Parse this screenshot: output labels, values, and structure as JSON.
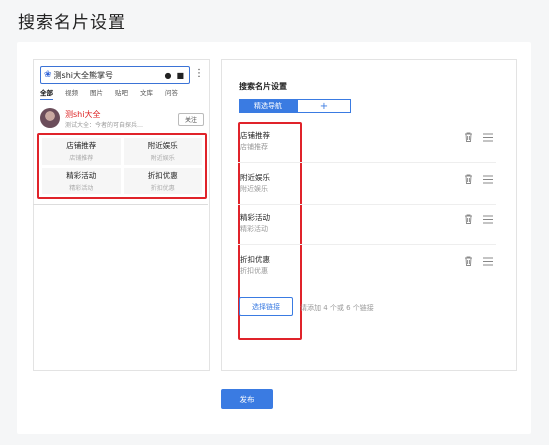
{
  "page": {
    "title": "搜索名片设置"
  },
  "preview": {
    "search_query": "测shi大全熊掌号",
    "tabs": [
      "全部",
      "视频",
      "图片",
      "贴吧",
      "文库",
      "问答"
    ],
    "profile": {
      "name": "测shi大全",
      "desc": "测试大全：今者的可自探兵…",
      "follow_label": "关注"
    },
    "grid": [
      {
        "title": "店铺推荐",
        "sub": "店铺推荐"
      },
      {
        "title": "附近娱乐",
        "sub": "附近娱乐"
      },
      {
        "title": "精彩活动",
        "sub": "精彩活动"
      },
      {
        "title": "折扣优惠",
        "sub": "折扣优惠"
      }
    ]
  },
  "settings": {
    "title": "搜索名片设置",
    "tab_active": "精选导航",
    "tab_add": "+",
    "items": [
      {
        "title": "店铺推荐",
        "sub": "店铺推荐"
      },
      {
        "title": "附近娱乐",
        "sub": "附近娱乐"
      },
      {
        "title": "精彩活动",
        "sub": "精彩活动"
      },
      {
        "title": "折扣优惠",
        "sub": "折扣优惠"
      }
    ],
    "choose_label": "选择链接",
    "hint": "请添加 4 个或 6 个链接"
  },
  "publish_label": "发布",
  "colors": {
    "accent": "#3a7be2",
    "highlight": "#e0232a"
  }
}
